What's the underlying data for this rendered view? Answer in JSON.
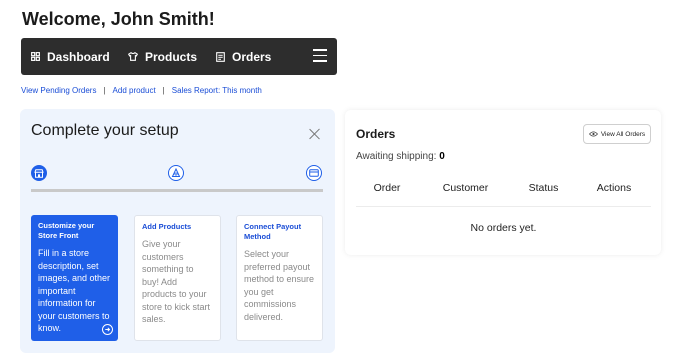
{
  "header": {
    "welcome": "Welcome, John Smith!"
  },
  "nav": {
    "items": [
      {
        "label": "Dashboard",
        "icon": "dashboard-icon"
      },
      {
        "label": "Products",
        "icon": "shirt-icon"
      },
      {
        "label": "Orders",
        "icon": "orders-icon"
      }
    ],
    "menu_icon": "hamburger-icon"
  },
  "quick_links": [
    "View Pending Orders",
    "Add product",
    "Sales Report: This month"
  ],
  "setup": {
    "title": "Complete your setup",
    "steps": [
      {
        "icon": "storefront-icon",
        "state": "active"
      },
      {
        "icon": "product-icon",
        "state": "idle"
      },
      {
        "icon": "payout-icon",
        "state": "idle"
      }
    ],
    "cards": [
      {
        "title": "Customize your Store Front",
        "body": "Fill in a store description, set images, and other important information for your customers to know.",
        "state": "active"
      },
      {
        "title": "Add Products",
        "body": "Give your customers something to buy! Add products to your store to kick start sales.",
        "state": "idle"
      },
      {
        "title": "Connect Payout Method",
        "body": "Select your preferred payout method to ensure you get commissions delivered.",
        "state": "idle"
      }
    ],
    "accent": "#1f5fe8"
  },
  "orders": {
    "title": "Orders",
    "view_all": "View All Orders",
    "awaiting_label": "Awaiting shipping:",
    "awaiting_count": "0",
    "columns": [
      "Order",
      "Customer",
      "Status",
      "Actions"
    ],
    "empty": "No orders yet."
  }
}
